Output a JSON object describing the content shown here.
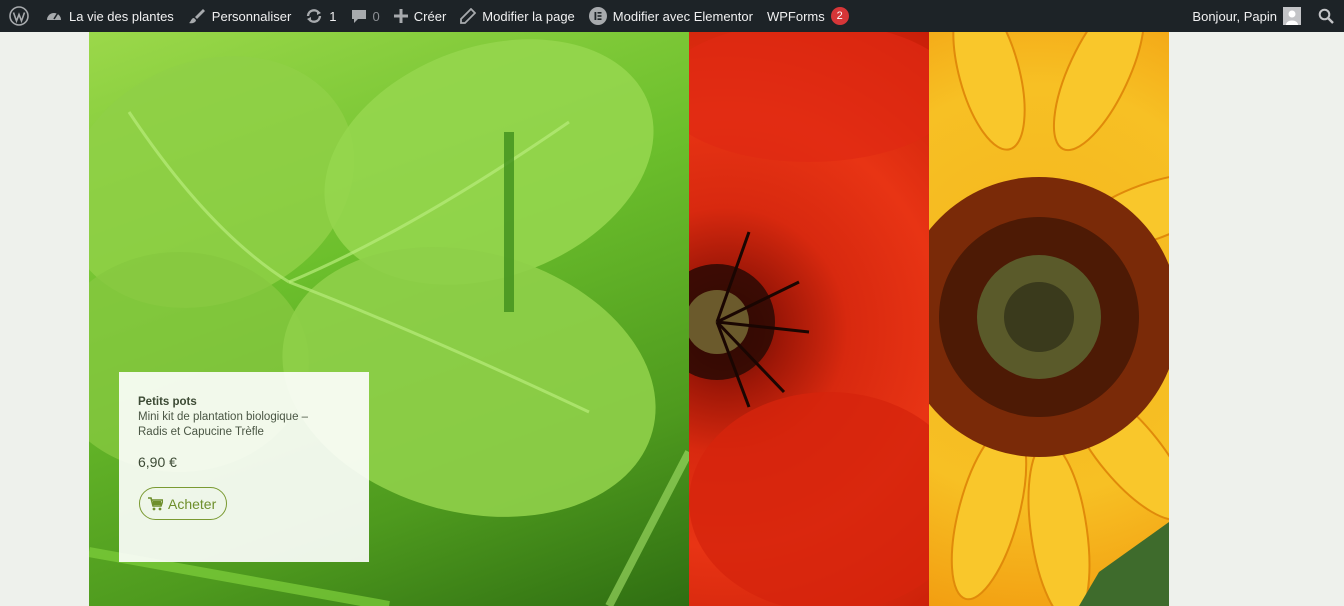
{
  "adminbar": {
    "site_name": "La vie des plantes",
    "customize": "Personnaliser",
    "updates_count": "1",
    "comments_count": "0",
    "new_label": "Créer",
    "edit_page": "Modifier la page",
    "elementor": "Modifier avec Elementor",
    "wpforms": "WPForms",
    "wpforms_badge": "2",
    "greeting": "Bonjour, Papin"
  },
  "product": {
    "category": "Petits pots",
    "name": "Mini kit de plantation biologique – Radis et Capucine Trèfle",
    "price": "6,90 €",
    "buy_label": "Acheter"
  },
  "colors": {
    "adminbar_bg": "#1d2327",
    "accent_green": "#7a9a32",
    "badge_red": "#d63638",
    "page_bg": "#eef1ec"
  }
}
